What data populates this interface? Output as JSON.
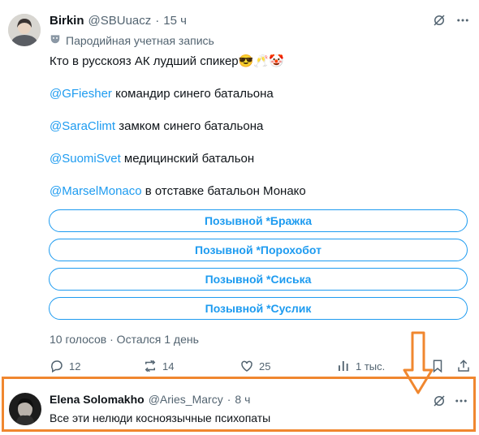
{
  "tweet1": {
    "author_name": "Birkin",
    "author_handle": "@SBUuacz",
    "separator": "·",
    "time": "15 ч",
    "parody_label": "Пародийная учетная запись",
    "text_main": "Кто в русскояз АК лудший спикер",
    "emojis": "😎🥂🤡",
    "lines": [
      {
        "mention": "@GFiesher",
        "text": " командир синего батальона"
      },
      {
        "mention": "@SaraClimt",
        "text": " замком синего батальона"
      },
      {
        "mention": "@SuomiSvet",
        "text": " медицинский батальон"
      },
      {
        "mention": "@MarselMonaco",
        "text": " в отставке батальон Монако"
      }
    ],
    "poll_options": [
      "Позывной *Бражка",
      "Позывной *Порохобот",
      "Позывной *Сиська",
      "Позывной *Суслик"
    ],
    "poll_meta": "10 голосов · Остался 1 день",
    "actions": {
      "replies": "12",
      "retweets": "14",
      "likes": "25",
      "views": "1 тыс."
    }
  },
  "tweet2": {
    "author_name": "Elena Solomakho",
    "author_handle": "@Aries_Marcy",
    "separator": "·",
    "time": "8 ч",
    "text": "Все эти нелюди косноязычные психопаты"
  },
  "colors": {
    "accent": "#1d9bf0",
    "highlight": "#f0872f",
    "muted": "#536471"
  },
  "icons": [
    "grok-icon",
    "more-icon",
    "parody-mask-icon",
    "reply-icon",
    "retweet-icon",
    "like-icon",
    "views-icon",
    "bookmark-icon",
    "share-icon",
    "arrow-down-annotation"
  ]
}
